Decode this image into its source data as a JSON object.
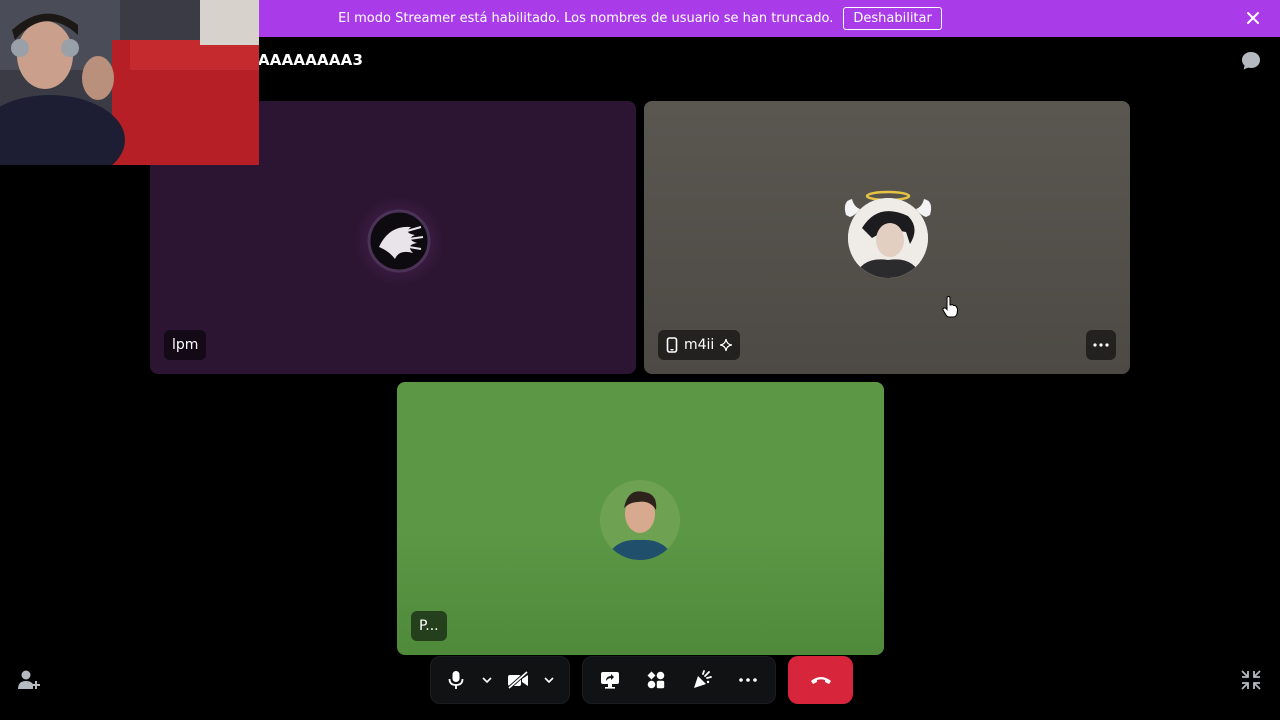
{
  "banner": {
    "message": "El modo Streamer está habilitado. Los nombres de usuario se han truncado.",
    "disable_label": "Deshabilitar"
  },
  "channel": {
    "title": "AAAAAAAA3"
  },
  "participants": [
    {
      "name": "lpm",
      "tile_color": "#2c1533"
    },
    {
      "name": "m4ii",
      "tile_color": "#56534e"
    },
    {
      "name": "P...",
      "tile_color": "#5b9745"
    }
  ],
  "colors": {
    "banner": "#a93be8",
    "hangup": "#d7253c"
  },
  "icons": {
    "banner_close": "close-icon",
    "chat": "chat-bubble-icon",
    "invite": "add-user-icon",
    "collapse": "collapse-icon",
    "mic": "microphone-icon",
    "camera": "camera-off-icon",
    "share": "screen-share-icon",
    "activities": "activities-icon",
    "soundboard": "soundboard-icon",
    "more": "more-icon",
    "hangup": "hang-up-icon"
  }
}
